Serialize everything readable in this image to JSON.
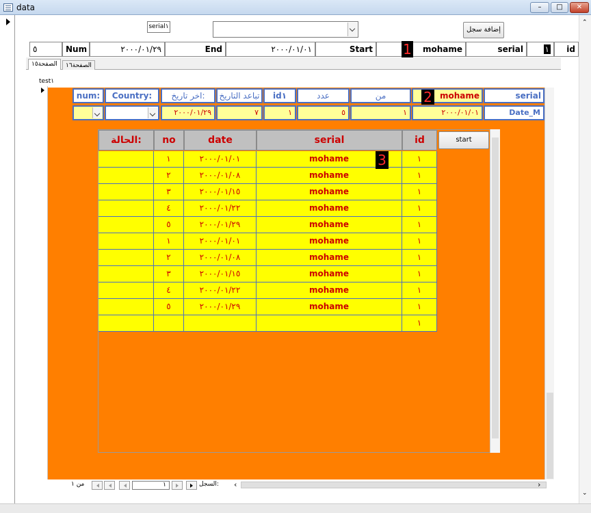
{
  "window": {
    "title": "data"
  },
  "toolbar": {
    "serial_box": "serial١",
    "add_record_label": "إضافة سجل",
    "combo_value": ""
  },
  "header": {
    "num_value": "٥",
    "num_label": "Num",
    "end_value": "٢٠٠٠/٠١/٢٩",
    "end_label": "End",
    "start_value": "٢٠٠٠/٠١/٠١",
    "start_label": "Start",
    "name_value": "mohame",
    "serial_label": "serial",
    "id_value": "١",
    "id_label": "id"
  },
  "badges": [
    "1",
    "2",
    "3"
  ],
  "tabs": [
    {
      "label": "الصفحة١٥"
    },
    {
      "label": "الصفحة١٦"
    }
  ],
  "subform": {
    "label": "test١",
    "columns": [
      {
        "label": "num:"
      },
      {
        "label": "Country:"
      },
      {
        "label": "اخر تاريخ:"
      },
      {
        "label": "تباعد التاريخ"
      },
      {
        "label": "id١"
      },
      {
        "label": "عدد"
      },
      {
        "label": "من"
      },
      {
        "label": "mohame"
      },
      {
        "label": "serial"
      }
    ],
    "values": {
      "num": "",
      "country": "",
      "last_date": "٢٠٠٠/٠١/٢٩",
      "spacing": "٧",
      "id1": "١",
      "count": "٥",
      "from": "١",
      "date": "٢٠٠٠/٠١/٠١",
      "date_label": "Date_M"
    }
  },
  "grid": {
    "headers": {
      "status": "الحالة:",
      "no": "no",
      "date": "date",
      "serial": "serial",
      "id": "id"
    },
    "start_label": "start",
    "rows": [
      {
        "no": "١",
        "date": "٢٠٠٠/٠١/٠١",
        "serial": "mohame",
        "id": "١"
      },
      {
        "no": "٢",
        "date": "٢٠٠٠/٠١/٠٨",
        "serial": "mohame",
        "id": "١"
      },
      {
        "no": "٣",
        "date": "٢٠٠٠/٠١/١٥",
        "serial": "mohame",
        "id": "١"
      },
      {
        "no": "٤",
        "date": "٢٠٠٠/٠١/٢٢",
        "serial": "mohame",
        "id": "١"
      },
      {
        "no": "٥",
        "date": "٢٠٠٠/٠١/٢٩",
        "serial": "mohame",
        "id": "١"
      },
      {
        "no": "١",
        "date": "٢٠٠٠/٠١/٠١",
        "serial": "mohame",
        "id": "١"
      },
      {
        "no": "٢",
        "date": "٢٠٠٠/٠١/٠٨",
        "serial": "mohame",
        "id": "١"
      },
      {
        "no": "٣",
        "date": "٢٠٠٠/٠١/١٥",
        "serial": "mohame",
        "id": "١"
      },
      {
        "no": "٤",
        "date": "٢٠٠٠/٠١/٢٢",
        "serial": "mohame",
        "id": "١"
      },
      {
        "no": "٥",
        "date": "٢٠٠٠/٠١/٢٩",
        "serial": "mohame",
        "id": "١"
      },
      {
        "no": "",
        "date": "",
        "serial": "",
        "id": "١"
      }
    ]
  },
  "navigation": {
    "record_label": "السجل:",
    "current": "١",
    "of_label": "من ١"
  },
  "colors": {
    "accent_orange": "#ff7f00",
    "grid_yellow": "#ffff00",
    "header_blue": "#4a6fc3",
    "text_red": "#cc0000"
  }
}
